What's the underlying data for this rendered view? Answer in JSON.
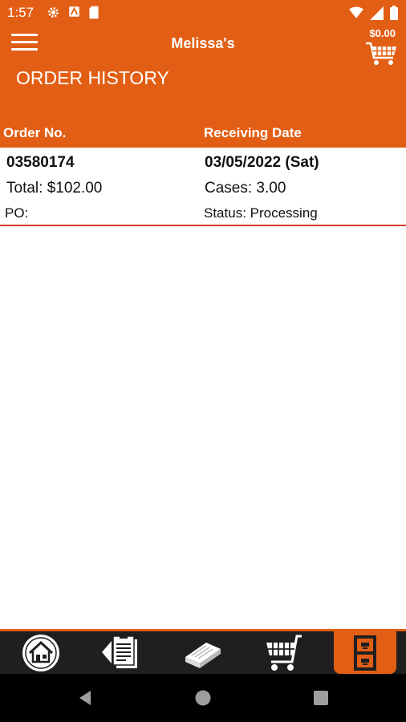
{
  "status_bar": {
    "time": "1:57",
    "left_icons": [
      "settings-icon",
      "notification-icon",
      "sd-card-icon"
    ],
    "right_icons": [
      "wifi-icon",
      "signal-icon",
      "battery-icon"
    ]
  },
  "app_bar": {
    "title": "Melissa's",
    "cart_total": "$0.00",
    "page_heading": "ORDER HISTORY",
    "columns": {
      "order_no": "Order No.",
      "receiving_date": "Receiving Date"
    }
  },
  "orders": [
    {
      "order_no": "03580174",
      "receiving_date": "03/05/2022 (Sat)",
      "total": "Total: $102.00",
      "cases": "Cases: 3.00",
      "po": "PO:",
      "status": "Status: Processing"
    }
  ],
  "tabs": [
    {
      "name": "home-icon"
    },
    {
      "name": "order-guide-icon"
    },
    {
      "name": "catalog-book-icon"
    },
    {
      "name": "shopping-cart-icon"
    },
    {
      "name": "order-history-icon",
      "active": true
    }
  ],
  "colors": {
    "brand_orange": "#e25e14",
    "divider_red": "#d93a2a",
    "tab_bar": "#1f1f1f"
  }
}
